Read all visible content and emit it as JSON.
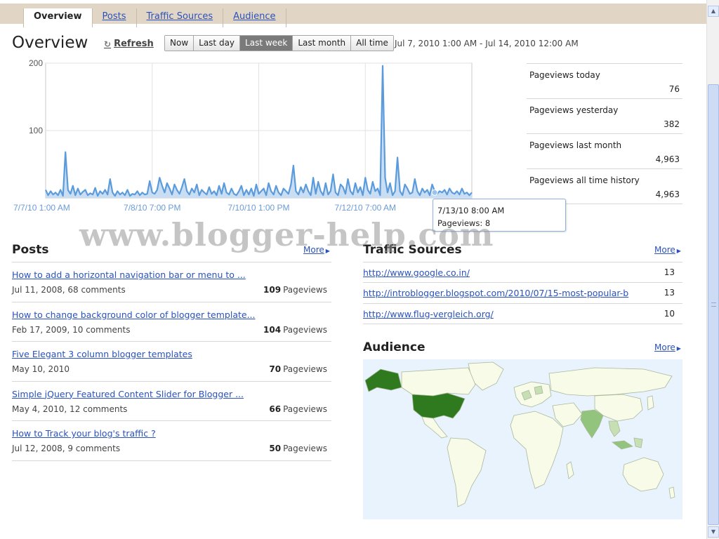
{
  "tabs": [
    {
      "label": "Overview",
      "active": true
    },
    {
      "label": "Posts",
      "active": false
    },
    {
      "label": "Traffic Sources",
      "active": false
    },
    {
      "label": "Audience",
      "active": false
    }
  ],
  "header": {
    "title": "Overview",
    "refresh_label": "Refresh",
    "date_range": "Jul 7, 2010 1:00 AM - Jul 14, 2010 12:00 AM"
  },
  "range_buttons": [
    {
      "label": "Now",
      "active": false
    },
    {
      "label": "Last day",
      "active": false
    },
    {
      "label": "Last week",
      "active": true
    },
    {
      "label": "Last month",
      "active": false
    },
    {
      "label": "All time",
      "active": false
    }
  ],
  "chart_data": {
    "type": "area",
    "ylim": [
      0,
      200
    ],
    "y_ticks": [
      100,
      200
    ],
    "x_tick_labels": [
      "7/7/10 1:00 AM",
      "7/8/10 7:00 PM",
      "7/10/10 1:00 PM",
      "7/12/10 7:00 AM"
    ],
    "color": "#5b9bdc",
    "fill": "#c9def3",
    "values": [
      12,
      4,
      10,
      5,
      8,
      4,
      12,
      3,
      68,
      12,
      6,
      18,
      4,
      14,
      5,
      9,
      12,
      4,
      7,
      5,
      15,
      3,
      10,
      6,
      12,
      5,
      28,
      8,
      3,
      10,
      5,
      8,
      4,
      12,
      3,
      6,
      5,
      10,
      4,
      8,
      5,
      6,
      25,
      8,
      6,
      12,
      30,
      18,
      8,
      22,
      14,
      5,
      20,
      12,
      6,
      16,
      28,
      10,
      5,
      14,
      8,
      20,
      4,
      12,
      8,
      5,
      16,
      6,
      10,
      4,
      18,
      6,
      22,
      8,
      5,
      14,
      6,
      4,
      10,
      18,
      4,
      12,
      5,
      14,
      3,
      20,
      6,
      10,
      14,
      4,
      22,
      10,
      5,
      18,
      8,
      4,
      14,
      10,
      6,
      20,
      48,
      10,
      5,
      16,
      8,
      20,
      10,
      4,
      30,
      6,
      24,
      10,
      4,
      22,
      5,
      10,
      35,
      8,
      4,
      20,
      16,
      6,
      28,
      10,
      5,
      22,
      8,
      16,
      4,
      30,
      12,
      6,
      24,
      10,
      14,
      4,
      196,
      30,
      8,
      22,
      4,
      10,
      60,
      10,
      4,
      20,
      14,
      6,
      8,
      28,
      10,
      4,
      14,
      8,
      12,
      4,
      20,
      10,
      6,
      10,
      8,
      12,
      5,
      14,
      8,
      6,
      10,
      5,
      14,
      6,
      8,
      4,
      8
    ],
    "tooltip": {
      "time": "7/13/10 8:00 AM",
      "pageviews": 8
    }
  },
  "tooltip": {
    "line1": "7/13/10 8:00 AM",
    "line2": "Pageviews: 8"
  },
  "stats": [
    {
      "label": "Pageviews today",
      "value": "76"
    },
    {
      "label": "Pageviews yesterday",
      "value": "382"
    },
    {
      "label": "Pageviews last month",
      "value": "4,963"
    },
    {
      "label": "Pageviews all time history",
      "value": "4,963"
    }
  ],
  "watermark": "www.blogger-help.com",
  "posts_section": {
    "title": "Posts",
    "more_label": "More",
    "pageviews_label": "Pageviews",
    "items": [
      {
        "title": "How to add a horizontal navigation bar or menu to ...",
        "meta": "Jul 11, 2008, 68 comments",
        "views": "109"
      },
      {
        "title": "How to change background color of blogger template...",
        "meta": "Feb 17, 2009, 10 comments",
        "views": "104"
      },
      {
        "title": "Five Elegant 3 column blogger templates",
        "meta": "May 10, 2010",
        "views": "70"
      },
      {
        "title": "Simple jQuery Featured Content Slider for Blogger ...",
        "meta": "May 4, 2010, 12 comments",
        "views": "66"
      },
      {
        "title": "How to Track your blog's traffic ?",
        "meta": "Jul 12, 2008, 9 comments",
        "views": "50"
      }
    ]
  },
  "traffic_section": {
    "title": "Traffic Sources",
    "more_label": "More",
    "items": [
      {
        "url": "http://www.google.co.in/",
        "count": "13"
      },
      {
        "url": "http://introblogger.blogspot.com/2010/07/15-most-popular-b",
        "count": "13"
      },
      {
        "url": "http://www.flug-vergleich.org/",
        "count": "10"
      }
    ]
  },
  "audience_section": {
    "title": "Audience",
    "more_label": "More",
    "colors": {
      "ocean": "#e9f3fd",
      "land": "#f7fbe8",
      "border": "#aab89a",
      "high": "#2f7a1f",
      "mid": "#93c47d",
      "low": "#c6e0b4"
    }
  }
}
